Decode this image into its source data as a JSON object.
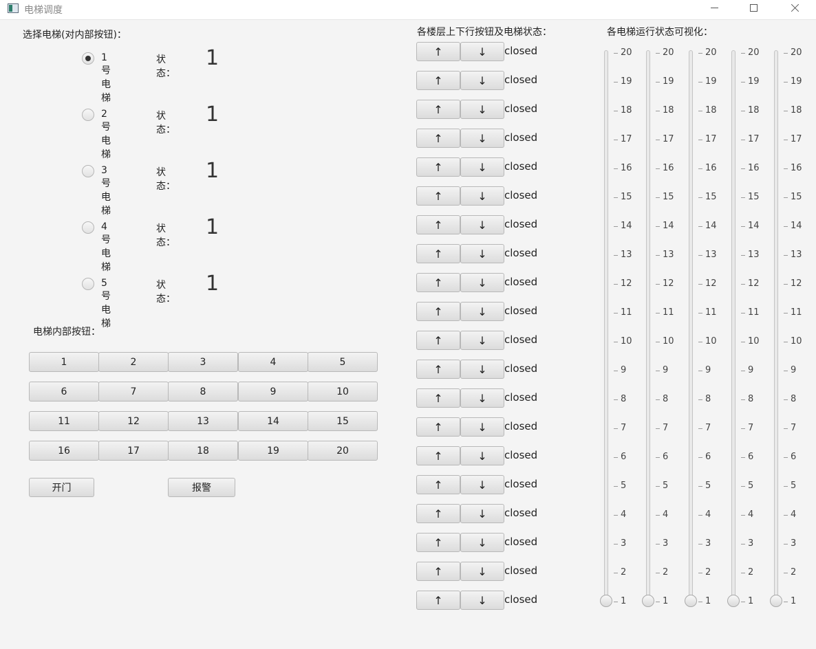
{
  "window": {
    "title": "电梯调度"
  },
  "labels": {
    "select_elevator": "选择电梯(对内部按钮)：",
    "floor_panel": "各楼层上下行按钮及电梯状态：",
    "visualization": "各电梯运行状态可视化：",
    "internal_buttons": "电梯内部按钮："
  },
  "elevators": [
    {
      "label": "1号电梯",
      "status_label": "状态：",
      "floor": "1",
      "selected": true
    },
    {
      "label": "2号电梯",
      "status_label": "状态：",
      "floor": "1",
      "selected": false
    },
    {
      "label": "3号电梯",
      "status_label": "状态：",
      "floor": "1",
      "selected": false
    },
    {
      "label": "4号电梯",
      "status_label": "状态：",
      "floor": "1",
      "selected": false
    },
    {
      "label": "5号电梯",
      "status_label": "状态：",
      "floor": "1",
      "selected": false
    }
  ],
  "internal_floor_buttons": [
    "1",
    "2",
    "3",
    "4",
    "5",
    "6",
    "7",
    "8",
    "9",
    "10",
    "11",
    "12",
    "13",
    "14",
    "15",
    "16",
    "17",
    "18",
    "19",
    "20"
  ],
  "action_buttons": {
    "open_door": "开门",
    "alarm": "报警"
  },
  "floor_calls": {
    "up_label": "↑",
    "down_label": "↓",
    "status_texts": [
      "closed",
      "closed",
      "closed",
      "closed",
      "closed",
      "closed",
      "closed",
      "closed",
      "closed",
      "closed",
      "closed",
      "closed",
      "closed",
      "closed",
      "closed",
      "closed",
      "closed",
      "closed",
      "closed",
      "closed"
    ]
  },
  "visualization": {
    "ticks": [
      "20",
      "19",
      "18",
      "17",
      "16",
      "15",
      "14",
      "13",
      "12",
      "11",
      "10",
      "9",
      "8",
      "7",
      "6",
      "5",
      "4",
      "3",
      "2",
      "1"
    ],
    "elevator_floors": [
      1,
      1,
      1,
      1,
      1
    ]
  }
}
